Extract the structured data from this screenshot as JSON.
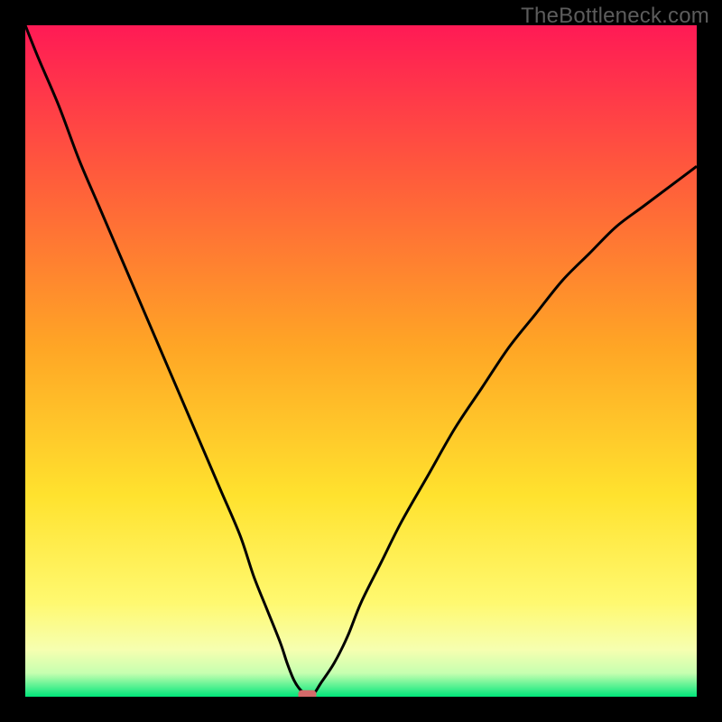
{
  "watermark": "TheBottleneck.com",
  "chart_data": {
    "type": "line",
    "title": "",
    "xlabel": "",
    "ylabel": "",
    "xlim": [
      0,
      100
    ],
    "ylim": [
      0,
      100
    ],
    "x": [
      0,
      2,
      5,
      8,
      11,
      14,
      17,
      20,
      23,
      26,
      29,
      32,
      34,
      36,
      38,
      39,
      40,
      41,
      42,
      43,
      44,
      46,
      48,
      50,
      53,
      56,
      60,
      64,
      68,
      72,
      76,
      80,
      84,
      88,
      92,
      96,
      100
    ],
    "values": [
      100,
      95,
      88,
      80,
      73,
      66,
      59,
      52,
      45,
      38,
      31,
      24,
      18,
      13,
      8,
      5,
      2.5,
      1,
      0.3,
      0.5,
      2,
      5,
      9,
      14,
      20,
      26,
      33,
      40,
      46,
      52,
      57,
      62,
      66,
      70,
      73,
      76,
      79
    ],
    "minimum_x": 42,
    "marker": {
      "x": 42,
      "y": 0.3,
      "color": "#d46a6a"
    },
    "gradient_stops": [
      {
        "offset": 0.0,
        "color": "#ff1a55"
      },
      {
        "offset": 0.22,
        "color": "#ff5a3c"
      },
      {
        "offset": 0.48,
        "color": "#ffa625"
      },
      {
        "offset": 0.7,
        "color": "#ffe22e"
      },
      {
        "offset": 0.86,
        "color": "#fff970"
      },
      {
        "offset": 0.93,
        "color": "#f6ffb0"
      },
      {
        "offset": 0.965,
        "color": "#c6ffb0"
      },
      {
        "offset": 1.0,
        "color": "#00e67a"
      }
    ],
    "curve_color": "#000000",
    "curve_width": 3
  }
}
